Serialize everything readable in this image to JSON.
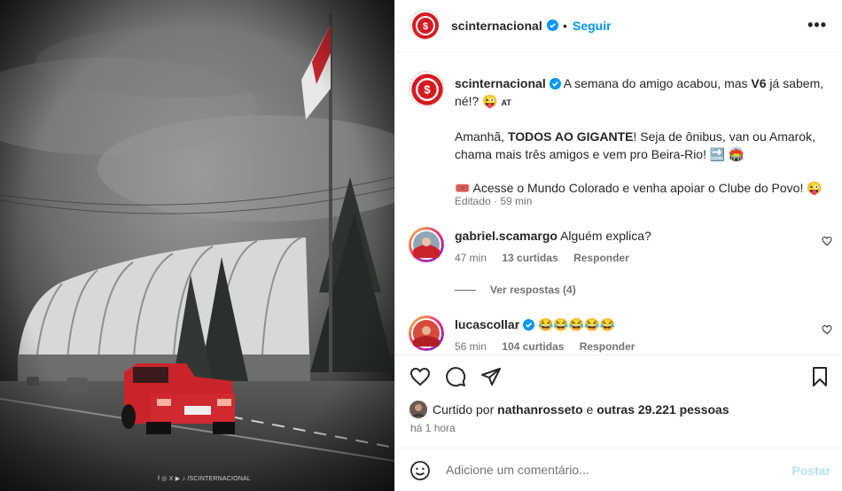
{
  "header": {
    "username": "scinternacional",
    "separator": "•",
    "follow_label": "Seguir",
    "more_label": "•••"
  },
  "caption": {
    "username": "scinternacional",
    "line1_a": "A semana do amigo acabou, mas ",
    "line1_b": "V6",
    "line1_c": " já sabem, né!? 😜",
    "line1_tag": "AT",
    "line2_a": "Amanhã, ",
    "line2_b": "TODOS AO GIGANTE",
    "line2_c": "! Seja de ônibus, van ou Amarok, chama mais três amigos e vem pro Beira-Rio! 🔜 🏟️",
    "line3": "🎟️ Acesse o Mundo Colorado e venha apoiar o Clube do Povo! 😜",
    "meta": "Editado · 59 min"
  },
  "comments": [
    {
      "username": "gabriel.scamargo",
      "text": "Alguém explica?",
      "time": "47 min",
      "likes": "13 curtidas",
      "reply": "Responder"
    },
    {
      "username": "lucascollar",
      "text": "😂😂😂😂😂",
      "time": "56 min",
      "likes": "104 curtidas",
      "reply": "Responder"
    }
  ],
  "view_replies": "Ver respostas (4)",
  "likes": {
    "prefix": "Curtido por ",
    "user": "nathanrosseto",
    "middle": " e ",
    "others": "outras 29.221 pessoas"
  },
  "time_ago": "há 1 hora",
  "add_comment": {
    "placeholder": "Adicione um comentário...",
    "post_label": "Postar"
  },
  "image": {
    "watermark": "f ◎ X ▶ ♪ /SCINTERNACIONAL"
  },
  "colors": {
    "accent": "#0095f6",
    "brand_red": "#d71920",
    "verified": "#0095f6"
  }
}
